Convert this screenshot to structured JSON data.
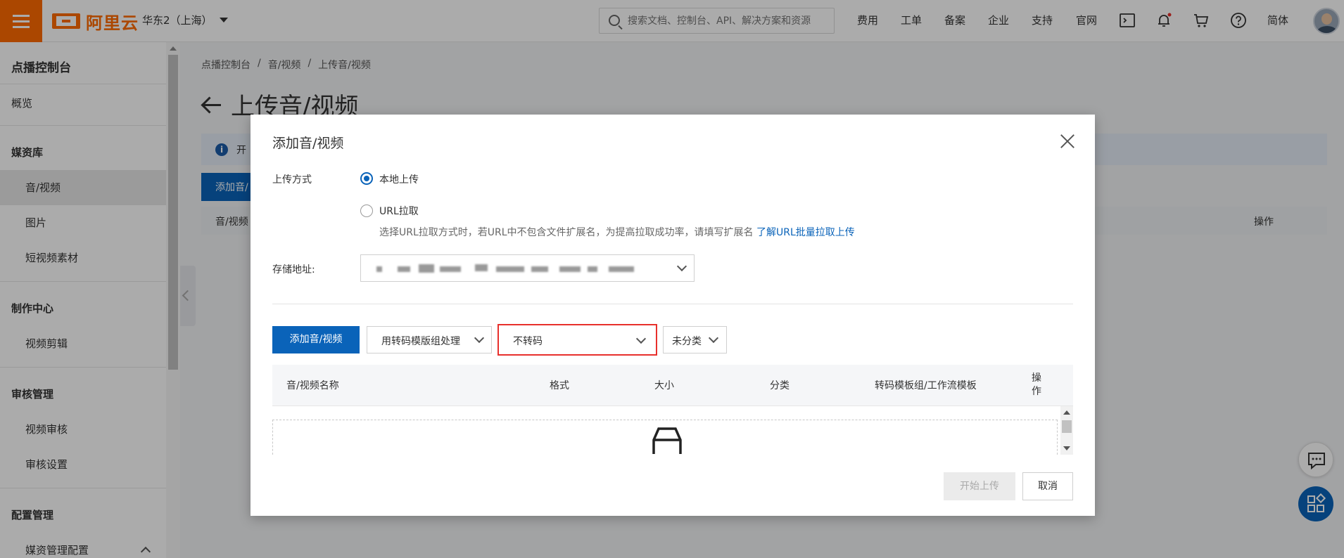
{
  "topbar": {
    "brand": "阿里云",
    "region": "华东2（上海）",
    "search_placeholder": "搜索文档、控制台、API、解决方案和资源",
    "nav": [
      "费用",
      "工单",
      "备案",
      "企业",
      "支持",
      "官网"
    ],
    "language": "简体"
  },
  "sidebar": {
    "title": "点播控制台",
    "overview": "概览",
    "groups": [
      {
        "label": "媒资库",
        "items": [
          "音/视频",
          "图片",
          "短视频素材"
        ]
      },
      {
        "label": "制作中心",
        "items": [
          "视频剪辑"
        ]
      },
      {
        "label": "审核管理",
        "items": [
          "视频审核",
          "审核设置"
        ]
      },
      {
        "label": "配置管理",
        "items": [
          "媒资管理配置"
        ]
      }
    ]
  },
  "breadcrumb": [
    "点播控制台",
    "/",
    "音/视频",
    "/",
    "上传音/视频"
  ],
  "page": {
    "title": "上传音/视频",
    "info_text": "开",
    "add_button": "添加音/",
    "col_name": "音/视频",
    "col_actions": "操作"
  },
  "dialog": {
    "title": "添加音/视频",
    "upload_mode_label": "上传方式",
    "option_local": "本地上传",
    "option_url": "URL拉取",
    "hint_text": "选择URL拉取方式时，若URL中不包含文件扩展名，为提高拉取成功率，请填写扩展名",
    "hint_link": "了解URL批量拉取上传",
    "storage_label": "存储地址:",
    "add_button": "添加音/视频",
    "transcode_mode": "用转码模版组处理",
    "transcode_value": "不转码",
    "category_value": "未分类",
    "columns": [
      "音/视频名称",
      "格式",
      "大小",
      "分类",
      "转码模板组/工作流模板",
      "操作"
    ],
    "start_button": "开始上传",
    "cancel_button": "取消"
  },
  "colors": {
    "brand_orange": "#ff6a00",
    "primary_blue": "#0a63b9",
    "highlight_red": "#e8302c"
  }
}
